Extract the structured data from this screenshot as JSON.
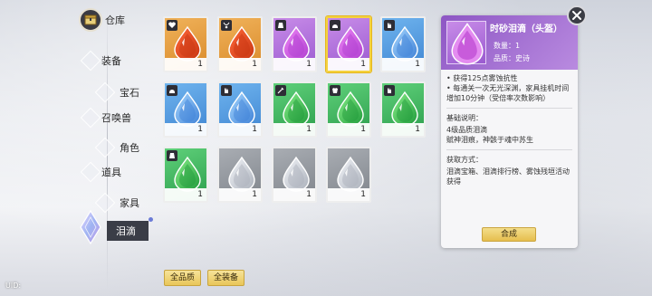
{
  "nav": {
    "storage_label": "仓库",
    "items": [
      {
        "label": "装备"
      },
      {
        "label": "宝石"
      },
      {
        "label": "召唤兽"
      },
      {
        "label": "角色"
      },
      {
        "label": "道具"
      },
      {
        "label": "家具"
      },
      {
        "label": "泪滴",
        "active": true
      }
    ]
  },
  "grid": {
    "slots": [
      {
        "color": "orange",
        "count": "1",
        "badge": "heart-icon"
      },
      {
        "color": "orange",
        "count": "1",
        "badge": "necklace-icon"
      },
      {
        "color": "purple",
        "count": "1",
        "badge": "robe-icon"
      },
      {
        "color": "purple",
        "count": "1",
        "badge": "helmet-icon",
        "selected": true
      },
      {
        "color": "blue",
        "count": "1",
        "badge": "gauntlet-icon"
      },
      {
        "color": "blue",
        "count": "1",
        "badge": "helmet-icon"
      },
      {
        "color": "blue",
        "count": "1",
        "badge": "gauntlet-icon"
      },
      {
        "color": "green",
        "count": "1",
        "badge": "sword-icon"
      },
      {
        "color": "green",
        "count": "1",
        "badge": "armor-icon"
      },
      {
        "color": "green",
        "count": "1",
        "badge": "gauntlet-icon"
      },
      {
        "color": "green",
        "count": "1",
        "badge": "robe-icon"
      },
      {
        "color": "gray",
        "count": "1",
        "badge": "none"
      },
      {
        "color": "gray",
        "count": "1",
        "badge": "none"
      },
      {
        "color": "gray",
        "count": "1",
        "badge": "none"
      }
    ]
  },
  "filters": {
    "quality_label": "全品质",
    "equipment_label": "全装备"
  },
  "detail": {
    "name": "时砂泪滴（头盔）",
    "quantity": "数量：1",
    "quality": "品质：史诗",
    "effects": [
      "• 获得125点雾蚀抗性",
      "• 每通关一次无光深渊，家具挂机时间增加10分钟（受倍率次数影响）"
    ],
    "desc_title": "基础说明：",
    "desc_lines": [
      "4级品质泪滴",
      "赋神泪痕，神骸于魂中苏生"
    ],
    "source_title": "获取方式：",
    "source_text": "泪滴宝箱、泪滴排行榜、雾蚀残垣活动获得",
    "combine_label": "合成"
  },
  "uid_label": "UID:",
  "colors": {
    "orange": "#e59a3c",
    "purple": "#b174dc",
    "blue": "#4f98e0",
    "green": "#3cb85e",
    "gray": "#90959c",
    "selected_border": "#f4d23f"
  }
}
